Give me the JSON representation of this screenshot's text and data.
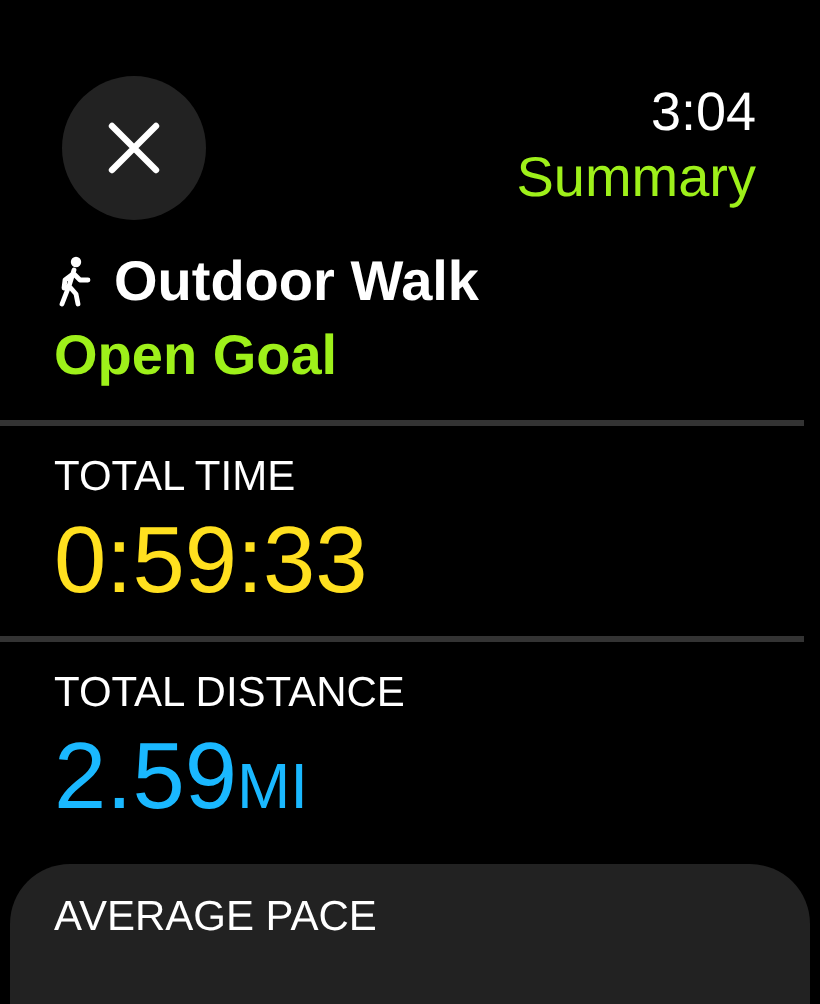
{
  "status": {
    "time": "3:04",
    "title": "Summary"
  },
  "workout": {
    "name": "Outdoor Walk",
    "goal": "Open Goal"
  },
  "metrics": [
    {
      "label": "TOTAL TIME",
      "value": "0:59:33",
      "color": "#ffe01f",
      "selected": false
    },
    {
      "label": "TOTAL DISTANCE",
      "value": "2.59",
      "unit": "MI",
      "color": "#1ab8ff",
      "selected": false
    },
    {
      "label": "AVERAGE PACE",
      "selected": true
    }
  ]
}
